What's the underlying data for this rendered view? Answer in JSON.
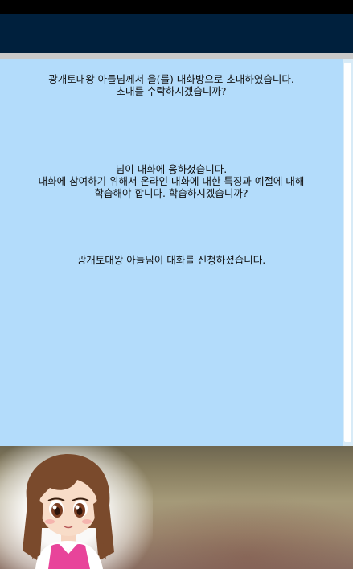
{
  "conversation": {
    "messages": [
      {
        "lines": [
          "광개토대왕 아들님께서 을(를) 대화방으로 초대하였습니다.",
          "초대를 수락하시겠습니까?"
        ]
      },
      {
        "lines": [
          "님이 대화에 응하셨습니다.",
          "대화에 참여하기 위해서 온라인 대화에 대한 특징과 예절에 대해",
          "학습해야 합니다. 학습하시겠습니까?"
        ]
      },
      {
        "lines": [
          "광개토대왕 아들님이 대화를 신청하셨습니다."
        ]
      }
    ]
  },
  "colors": {
    "app_bar": "#00203d",
    "message_background": "#b3dcfb",
    "character_shirt": "#e8449a"
  },
  "scene": {
    "character_icon": "girl-character-icon"
  }
}
